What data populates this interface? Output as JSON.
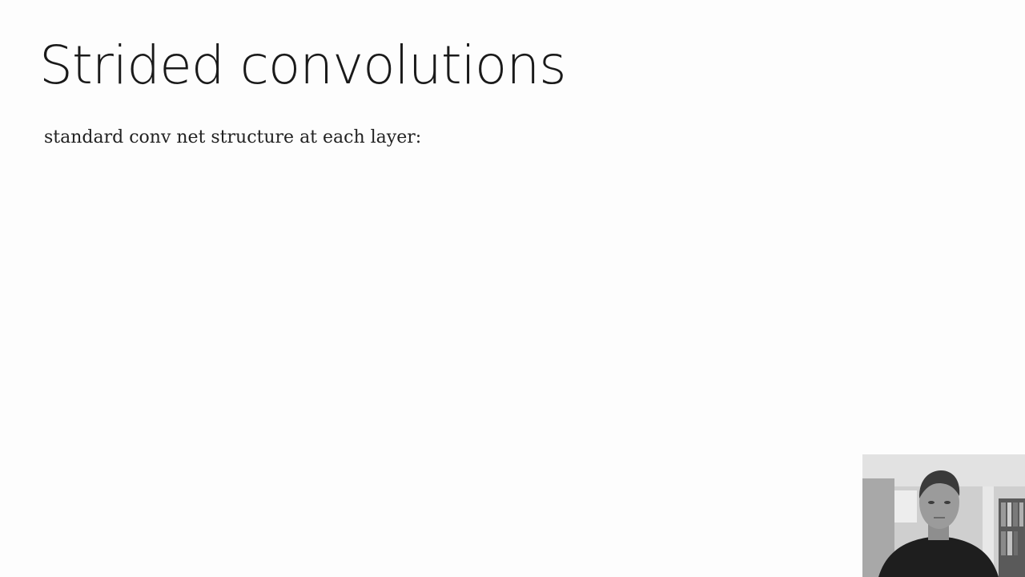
{
  "slide": {
    "title": "Strided convolutions",
    "body_text": "standard conv net structure at each layer:"
  },
  "webcam": {
    "icon": "presenter-video-feed",
    "description": "lecturer webcam thumbnail"
  },
  "colors": {
    "background": "#fdfdfd",
    "title_text": "#1a1a1a",
    "body_text": "#222222"
  }
}
